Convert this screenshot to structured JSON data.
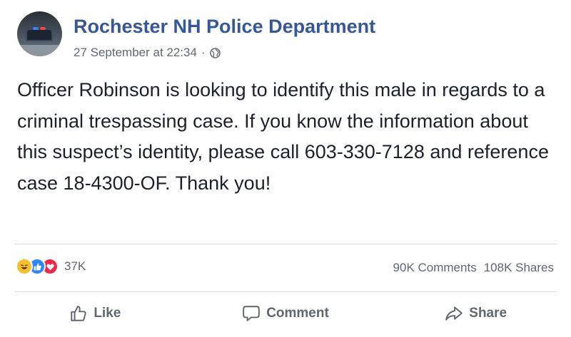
{
  "post": {
    "page_name": "Rochester NH Police Department",
    "timestamp": "27 September at 22:34",
    "separator": "·",
    "privacy_icon": "globe-icon",
    "body": "Officer Robinson is looking to identify this male in regards to a criminal trespassing case. If you know the information about this suspect’s identity, please call 603-330-7128 and reference case 18-4300-OF. Thank you!"
  },
  "reactions": {
    "icons": [
      "haha-icon",
      "like-icon",
      "love-icon"
    ],
    "count": "37K",
    "comments": "90K Comments",
    "shares": "108K Shares"
  },
  "actions": {
    "like": "Like",
    "comment": "Comment",
    "share": "Share"
  },
  "colors": {
    "page_name": "#365899",
    "meta_text": "#616770",
    "haha": "#f7c02b",
    "like": "#2d88ff",
    "love": "#f0284a"
  }
}
